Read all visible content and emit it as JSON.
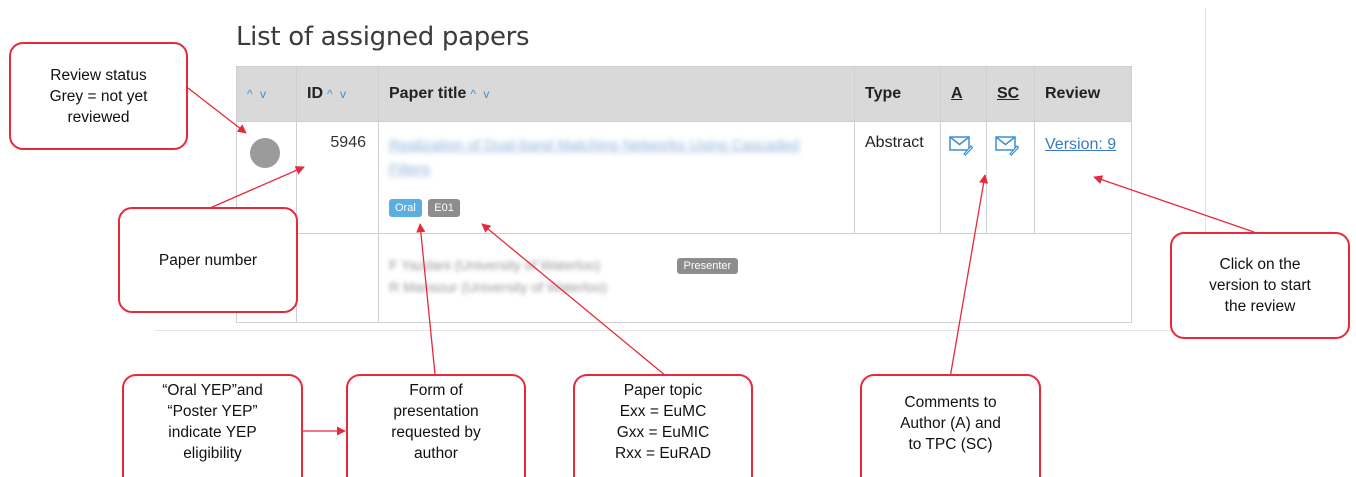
{
  "page": {
    "title": "List of assigned papers"
  },
  "table": {
    "headers": {
      "status": "",
      "id": "ID",
      "title": "Paper title",
      "type": "Type",
      "a": "A",
      "sc": "SC",
      "review": "Review"
    },
    "sort_glyph": "^ v",
    "rows": [
      {
        "status_color": "#9b9b9b",
        "id": "5946",
        "title": "Realization of Dual-band Matching Networks Using Cascaded Filters",
        "tags": [
          "Oral",
          "E01"
        ],
        "type": "Abstract",
        "review_link": "Version: 9",
        "authors": [
          {
            "name": "F Yazdani (University of Waterloo)",
            "badge": "Presenter"
          },
          {
            "name": "R Mansour (University of Waterloo)",
            "badge": ""
          }
        ]
      }
    ]
  },
  "callouts": {
    "review_status": "Review status\nGrey = not yet\nreviewed",
    "paper_number": "Paper number",
    "click_version": "Click on the\nversion to start\nthe review",
    "yep": "“Oral YEP”and\n“Poster YEP”\nindicate YEP\neligibility",
    "form": "Form of\npresentation\nrequested by\nauthor",
    "topic": "Paper topic\nExx = EuMC\nGxx = EuMIC\nRxx = EuRAD",
    "comments": "Comments to\nAuthor (A) and\nto TPC (SC)"
  },
  "colors": {
    "callout_border": "#e8293b",
    "arrow": "#e8293b",
    "header_bg": "#d9d9d9",
    "link": "#3a7ac0",
    "sort_arrows": "#3a8fd6"
  }
}
